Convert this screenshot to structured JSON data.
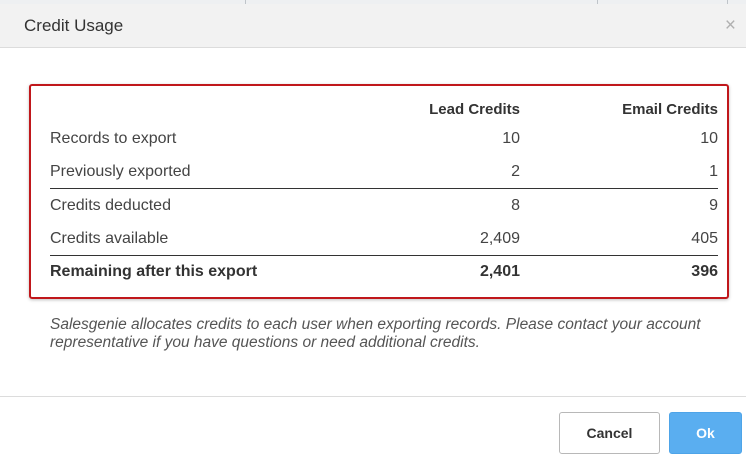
{
  "dialog": {
    "title": "Credit Usage",
    "close_symbol": "×"
  },
  "table": {
    "columns": [
      "",
      "Lead Credits",
      "Email Credits"
    ],
    "rows": [
      {
        "label": "Records to export",
        "lead": "10",
        "email": "10"
      },
      {
        "label": "Previously exported",
        "lead": "2",
        "email": "1"
      },
      {
        "label": "Credits deducted",
        "lead": "8",
        "email": "9"
      },
      {
        "label": "Credits available",
        "lead": "2,409",
        "email": "405"
      },
      {
        "label": "Remaining after this export",
        "lead": "2,401",
        "email": "396"
      }
    ]
  },
  "note": "Salesgenie allocates credits to each user when exporting records. Please contact your account representative if you have questions or need additional credits.",
  "buttons": {
    "cancel": "Cancel",
    "ok": "Ok"
  },
  "colors": {
    "highlight_border": "#c0171b",
    "ok_button": "#5aaef0"
  }
}
